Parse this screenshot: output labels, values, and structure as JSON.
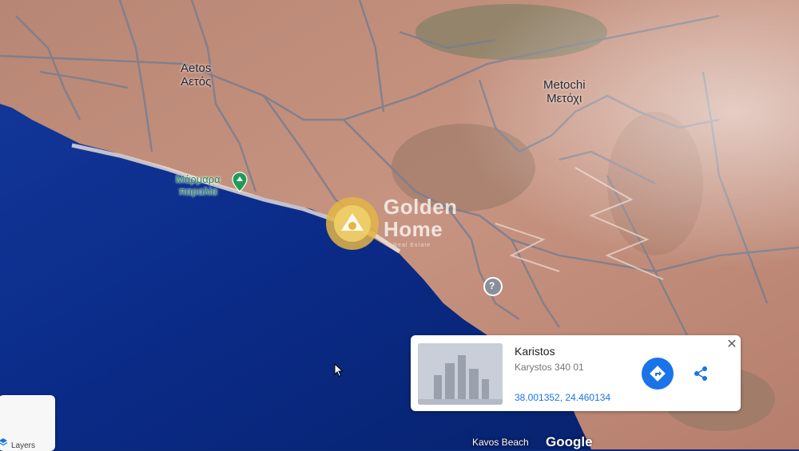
{
  "map": {
    "places": [
      {
        "name_latin": "Aetos",
        "name_greek": "Αετός"
      },
      {
        "name_latin": "Metochi",
        "name_greek": "Μετόχι"
      }
    ],
    "beach": {
      "line1": "Μάρμαρα",
      "line2": "παραλία"
    },
    "bottom_place": "Kavos Beach",
    "attribution": "Google"
  },
  "watermark": {
    "line1": "Golden",
    "line2": "Home",
    "sub": "Real Estate"
  },
  "place_card": {
    "title": "Karistos",
    "address": "Karystos 340 01",
    "coordinates": "38.001352, 24.460134",
    "directions_icon": "directions-icon",
    "share_icon": "share-icon",
    "close_label": "✕"
  },
  "layers": {
    "label": "Layers"
  },
  "colors": {
    "sea": "#0b2a7a",
    "land": "#c08a74",
    "accent": "#1a73e8",
    "beach_green": "#1f8a4d"
  }
}
